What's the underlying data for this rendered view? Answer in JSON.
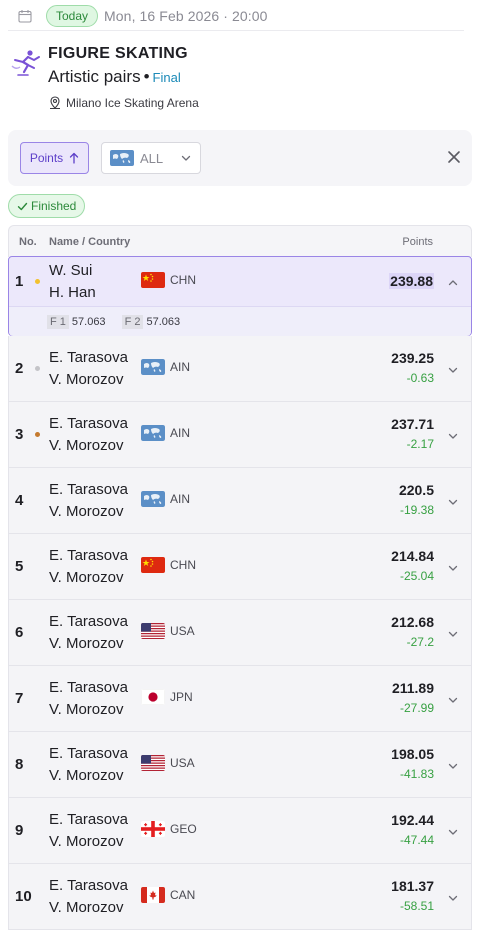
{
  "header": {
    "today_label": "Today",
    "datetime": "Mon, 16 Feb 2026 · 20:00"
  },
  "event": {
    "sport": "FIGURE SKATING",
    "discipline": "Artistic pairs",
    "separator": "•",
    "stage": "Final",
    "venue": "Milano Ice Skating Arena"
  },
  "filters": {
    "sort_label": "Points",
    "country_value": "ALL"
  },
  "status": {
    "label": "Finished"
  },
  "table": {
    "headers": {
      "no": "No.",
      "name": "Name / Country",
      "points": "Points"
    },
    "splits": [
      {
        "tag": "F 1",
        "value": "57.063"
      },
      {
        "tag": "F 2",
        "value": "57.063"
      }
    ],
    "rows": [
      {
        "rank": "1",
        "medal": "gold",
        "names": [
          "W. Sui",
          "H. Han"
        ],
        "country": "CHN",
        "points": "239.88",
        "diff": ""
      },
      {
        "rank": "2",
        "medal": "silver",
        "names": [
          "E. Tarasova",
          "V. Morozov"
        ],
        "country": "AIN",
        "points": "239.25",
        "diff": "-0.63"
      },
      {
        "rank": "3",
        "medal": "bronze",
        "names": [
          "E. Tarasova",
          "V. Morozov"
        ],
        "country": "AIN",
        "points": "237.71",
        "diff": "-2.17"
      },
      {
        "rank": "4",
        "medal": "",
        "names": [
          "E. Tarasova",
          "V. Morozov"
        ],
        "country": "AIN",
        "points": "220.5",
        "diff": "-19.38"
      },
      {
        "rank": "5",
        "medal": "",
        "names": [
          "E. Tarasova",
          "V. Morozov"
        ],
        "country": "CHN",
        "points": "214.84",
        "diff": "-25.04"
      },
      {
        "rank": "6",
        "medal": "",
        "names": [
          "E. Tarasova",
          "V. Morozov"
        ],
        "country": "USA",
        "points": "212.68",
        "diff": "-27.2"
      },
      {
        "rank": "7",
        "medal": "",
        "names": [
          "E. Tarasova",
          "V. Morozov"
        ],
        "country": "JPN",
        "points": "211.89",
        "diff": "-27.99"
      },
      {
        "rank": "8",
        "medal": "",
        "names": [
          "E. Tarasova",
          "V. Morozov"
        ],
        "country": "USA",
        "points": "198.05",
        "diff": "-41.83"
      },
      {
        "rank": "9",
        "medal": "",
        "names": [
          "E. Tarasova",
          "V. Morozov"
        ],
        "country": "GEO",
        "points": "192.44",
        "diff": "-47.44"
      },
      {
        "rank": "10",
        "medal": "",
        "names": [
          "E. Tarasova",
          "V. Morozov"
        ],
        "country": "CAN",
        "points": "181.37",
        "diff": "-58.51"
      }
    ]
  },
  "icons": {
    "calendar": "calendar-icon",
    "sport": "figure-skating-icon",
    "venue": "location-pin-icon",
    "sort": "arrow-up-icon",
    "close": "close-icon",
    "expand": "chevron-down-icon",
    "collapse": "chevron-up-icon"
  },
  "colors": {
    "accent": "#5d3fc9",
    "positive": "#2c8a3b",
    "diff_green": "#37a042",
    "gold": "#f2c12e",
    "silver": "#c4c4c8",
    "bronze": "#c57a2f"
  }
}
